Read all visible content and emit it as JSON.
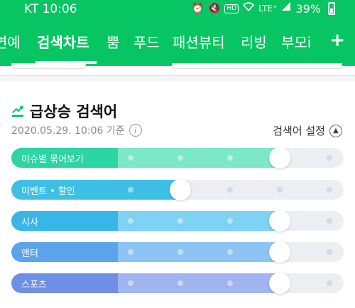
{
  "status_bar": {
    "carrier_time": "KT 10:06",
    "hd": "HD",
    "network": "LTE⁺",
    "battery": "39%"
  },
  "tabs": [
    "연예",
    "검색차트",
    "뿜",
    "푸드",
    "패션뷰티",
    "리빙",
    "부모i"
  ],
  "active_tab": "검색차트",
  "plus_label": "+",
  "section": {
    "title": "급상승 검색어",
    "timestamp": "2020.05.29. 10:06 기준",
    "info_label": "i",
    "setting_label": "검색어 설정",
    "setting_icon": "chevron-up-icon"
  },
  "sliders": [
    {
      "label": "이슈별 묶어보기",
      "level": 0.75,
      "color": "#2dd4a4",
      "color2": "#7de8c8"
    },
    {
      "label": "이벤트 • 할인",
      "level": 0.25,
      "color": "#3ec0e6",
      "color2": "#3ec0e6"
    },
    {
      "label": "시사",
      "level": 0.75,
      "color": "#39b6e8",
      "color2": "#7ed2f3"
    },
    {
      "label": "엔터",
      "level": 0.75,
      "color": "#5ba4ec",
      "color2": "#8cc4f5"
    },
    {
      "label": "스포츠",
      "level": 0.75,
      "color": "#6f8fe6",
      "color2": "#9fb4f0"
    }
  ]
}
